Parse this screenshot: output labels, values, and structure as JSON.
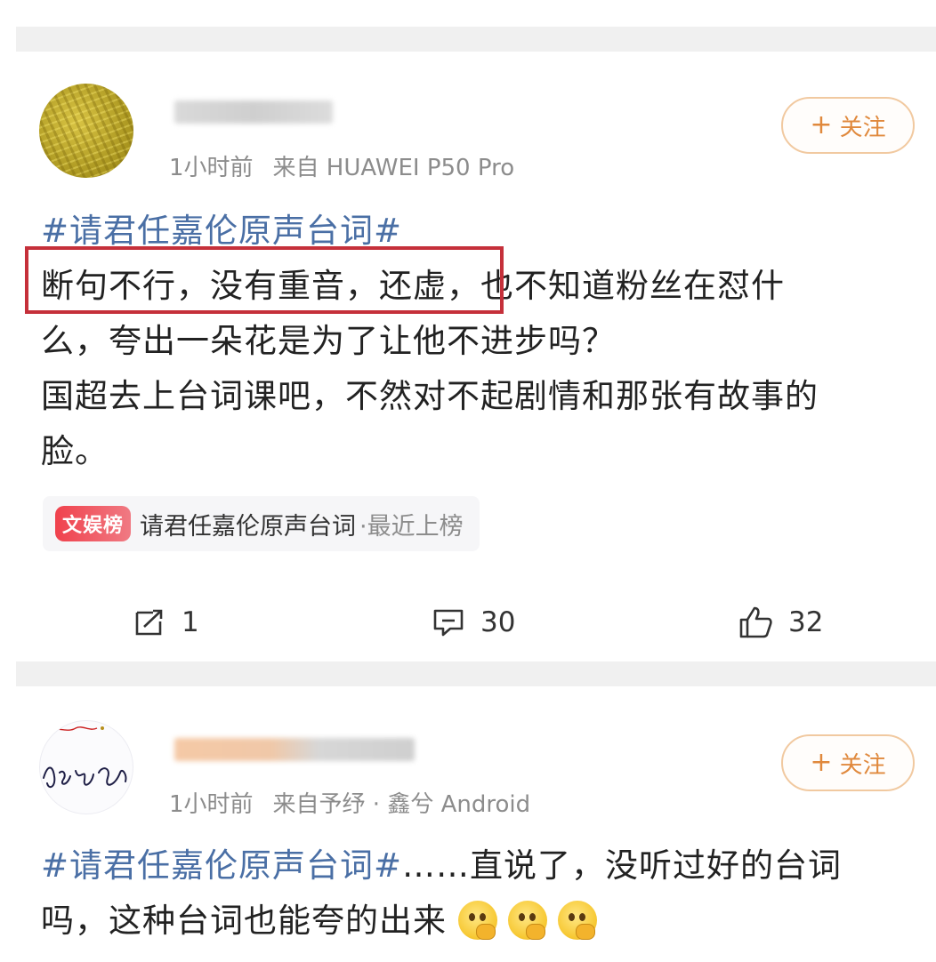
{
  "posts": [
    {
      "time": "1小时前",
      "source": "来自 HUAWEI P50 Pro",
      "follow_plus": "+",
      "follow_label": "关注",
      "topic": "#请君任嘉伦原声台词#",
      "highlighted_text": "断句不行，没有重音，还虚，",
      "line1_rest": "也不知道粉丝在怼什",
      "line2": "么，夸出一朵花是为了让他不进步吗？",
      "line3": "国超去上台词课吧，不然对不起剧情和那张有故事的",
      "line4": "脸。",
      "chip": {
        "badge": "文娱榜",
        "title": "请君任嘉伦原声台词",
        "suffix": "·最近上榜"
      },
      "actions": {
        "repost_count": "1",
        "comment_count": "30",
        "like_count": "32"
      }
    },
    {
      "avatar_signature": "自然而然",
      "time": "1小时前",
      "source": "来自予纾 · 鑫兮 Android",
      "follow_plus": "+",
      "follow_label": "关注",
      "topic": "#请君任嘉伦原声台词#",
      "line1_rest": "……直说了，没听过好的台词",
      "line2": "吗，这种台词也能夸的出来"
    }
  ],
  "colors": {
    "topic": "#4a6fa5",
    "follow_border": "#f1c9a0",
    "follow_text": "#e0893d",
    "highlight_box": "#c5303a",
    "badge": "#f0424d"
  },
  "icons": [
    "repost-icon",
    "comment-icon",
    "like-icon",
    "thinking-face-emoji"
  ]
}
